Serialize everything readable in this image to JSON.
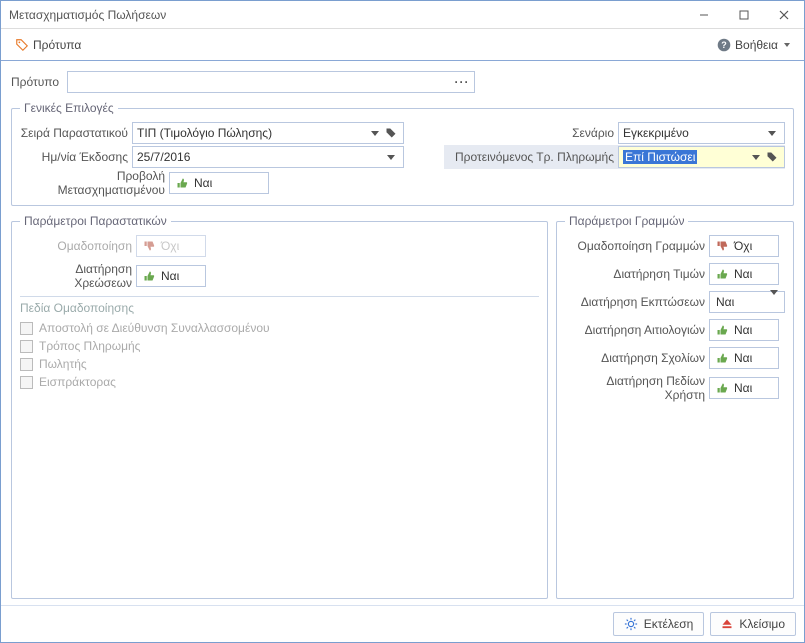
{
  "window": {
    "title": "Μετασχηματισμός Πωλήσεων"
  },
  "toolbar": {
    "templates": "Πρότυπα",
    "help": "Βοήθεια"
  },
  "template": {
    "label": "Πρότυπο",
    "value": ""
  },
  "general": {
    "legend": "Γενικές Επιλογές",
    "docSeries": {
      "label": "Σειρά Παραστατικού",
      "value": "ΤΙΠ (Τιμολόγιο Πώλησης)"
    },
    "issueDate": {
      "label": "Ημ/νία Έκδοσης",
      "value": "25/7/2016"
    },
    "viewTransformed": {
      "label": "Προβολή Μετασχηματισμένου",
      "value": "Ναι"
    },
    "scenario": {
      "label": "Σενάριο",
      "value": "Εγκεκριμένο"
    },
    "paymentMethod": {
      "label": "Προτεινόμενος Τρ. Πληρωμής",
      "value": "Επί Πιστώσει"
    }
  },
  "docParams": {
    "legend": "Παράμετροι Παραστατικών",
    "grouping": {
      "label": "Ομαδοποίηση",
      "value": "Όχι"
    },
    "keepCharges": {
      "label": "Διατήρηση Χρεώσεων",
      "value": "Ναι"
    },
    "groupingFields": {
      "heading": "Πεδία Ομαδοποίησης",
      "options": [
        "Αποστολή σε Διεύθυνση Συναλλασσομένου",
        "Τρόπος Πληρωμής",
        "Πωλητής",
        "Εισπράκτορας"
      ]
    }
  },
  "lineParams": {
    "legend": "Παράμετροι Γραμμών",
    "groupLines": {
      "label": "Ομαδοποίηση Γραμμών",
      "value": "Όχι"
    },
    "keepPrices": {
      "label": "Διατήρηση Τιμών",
      "value": "Ναι"
    },
    "keepDiscounts": {
      "label": "Διατήρηση Εκπτώσεων",
      "value": "Ναι"
    },
    "keepReasons": {
      "label": "Διατήρηση Αιτιολογιών",
      "value": "Ναι"
    },
    "keepComments": {
      "label": "Διατήρηση Σχολίων",
      "value": "Ναι"
    },
    "keepUserFields": {
      "label": "Διατήρηση Πεδίων Χρήστη",
      "value": "Ναι"
    }
  },
  "buttons": {
    "execute": "Εκτέλεση",
    "close": "Κλείσιμο"
  }
}
